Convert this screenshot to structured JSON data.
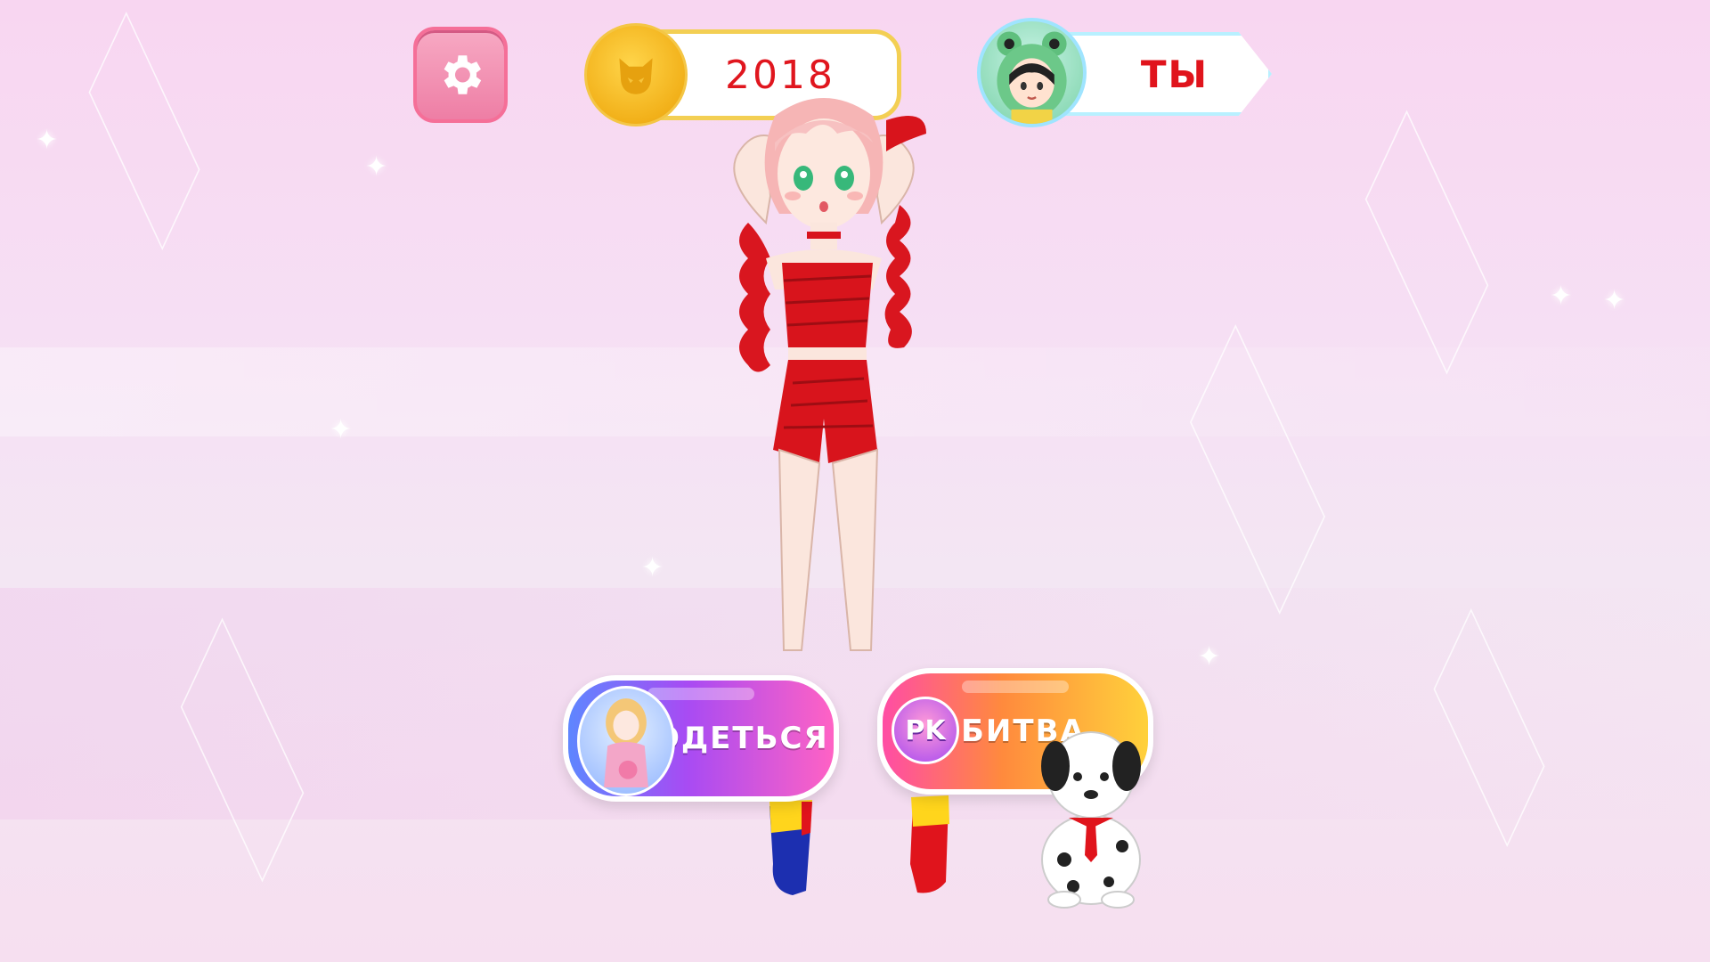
{
  "hud": {
    "settings_icon": "gear-icon",
    "coins": "2018",
    "coin_icon": "cat-face-coin-icon",
    "player_label": "ТЫ",
    "player_avatar": "frog-hood-girl-avatar"
  },
  "actions": {
    "dress_label": "ОДЕТЬСЯ",
    "dress_icon": "dressed-girl-icon",
    "battle_badge": "PK",
    "battle_label": "БИТВА"
  },
  "scene": {
    "character": "anime-girl-red-outfit",
    "pet": "dalmatian-puppy"
  },
  "colors": {
    "accent_red": "#e0161e",
    "settings_pink": "#ee7ea5",
    "coin_gold": "#f2b11a"
  }
}
